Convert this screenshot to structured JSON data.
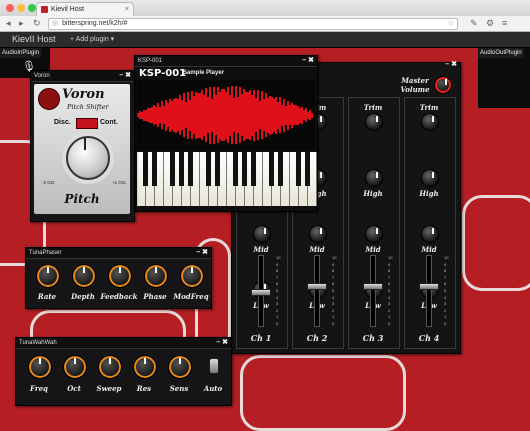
{
  "browser": {
    "tab_title": "Kievil Host",
    "tab_close": "×",
    "url": "bitterspring.net/k2h/#",
    "url_prefix": "◎",
    "nav_back": "◂",
    "nav_forward": "▸",
    "nav_reload": "↻",
    "star_icon": "☆",
    "menu_icons": [
      "✎",
      "⚙",
      "≡"
    ]
  },
  "app": {
    "name": "KievII Host",
    "add_plugin": "+ Add plugin ▾",
    "audio_in": "AudioInPlugin",
    "audio_out": "AudioOutPlugin"
  },
  "voron": {
    "window_title": "Voron",
    "controls": "– ✖",
    "name": "Voron",
    "subtitle": "Pitch Shifter",
    "disc": "Disc.",
    "cont": "Cont.",
    "min_label": "-2 Oct",
    "max_label": "+1 Oct.",
    "knob_label": "Pitch"
  },
  "ksp": {
    "window_title": "KSP-001",
    "controls": "– ✖",
    "name": "KSP-001",
    "subtitle": "Sample Player"
  },
  "mixer": {
    "controls": "– ✖",
    "master_label": "Master",
    "master_label2": "Volume",
    "row_labels": [
      "Trim",
      "High",
      "Mid",
      "Low"
    ],
    "scale": [
      "10",
      "9",
      "8",
      "7",
      "6",
      "5",
      "4",
      "3",
      "2",
      "1",
      "0"
    ],
    "channels": [
      "Ch 1",
      "Ch 2",
      "Ch 3",
      "Ch 4"
    ],
    "fader_levels": [
      0.45,
      0.55,
      0.55,
      0.55
    ]
  },
  "phaser": {
    "window_title": "TunaPhaser",
    "controls": "– ✖",
    "knobs": [
      "Rate",
      "Depth",
      "Feedback",
      "Phase",
      "ModFreq"
    ]
  },
  "wah": {
    "window_title": "TunaWahWah",
    "controls": "– ✖",
    "knobs": [
      "Freq",
      "Oct",
      "Sweep",
      "Res",
      "Sens"
    ],
    "toggle_label": "Auto"
  }
}
